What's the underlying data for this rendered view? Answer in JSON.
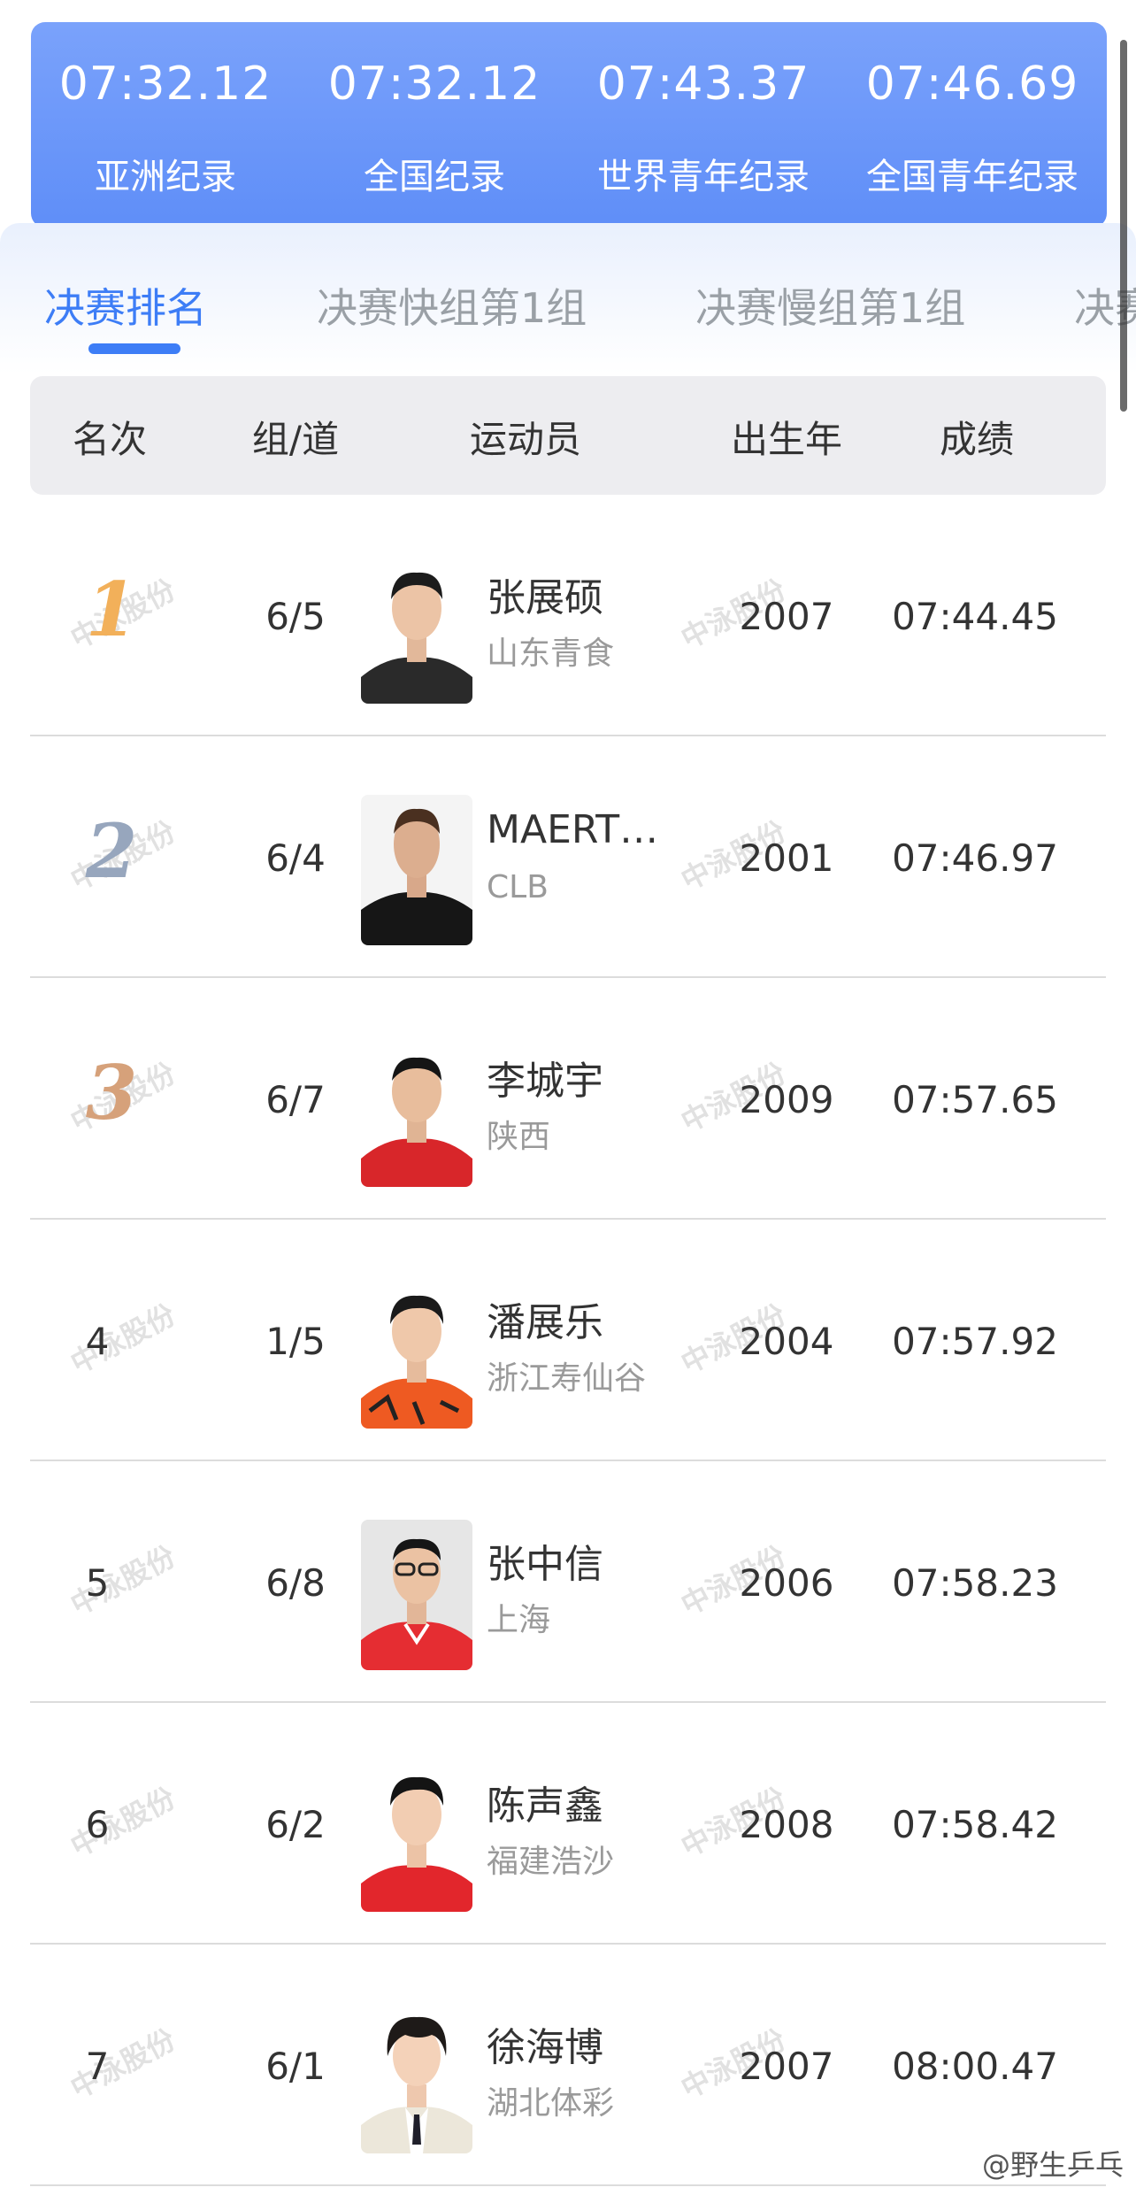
{
  "records": [
    {
      "time": "07:32.12",
      "label": "亚洲纪录"
    },
    {
      "time": "07:32.12",
      "label": "全国纪录"
    },
    {
      "time": "07:43.37",
      "label": "世界青年纪录"
    },
    {
      "time": "07:46.69",
      "label": "全国青年纪录"
    }
  ],
  "tabs": [
    "决赛排名",
    "决赛快组第1组",
    "决赛慢组第1组",
    "决赛"
  ],
  "header": {
    "rank": "名次",
    "lane": "组/道",
    "athlete": "运动员",
    "birth": "出生年",
    "score": "成绩"
  },
  "rows": [
    {
      "rank": "1",
      "lane": "6/5",
      "name": "张展硕",
      "team": "山东青食",
      "birth": "2007",
      "score": "07:44.45"
    },
    {
      "rank": "2",
      "lane": "6/4",
      "name": "MAERT…",
      "team": "CLB",
      "birth": "2001",
      "score": "07:46.97"
    },
    {
      "rank": "3",
      "lane": "6/7",
      "name": "李城宇",
      "team": "陕西",
      "birth": "2009",
      "score": "07:57.65"
    },
    {
      "rank": "4",
      "lane": "1/5",
      "name": "潘展乐",
      "team": "浙江寿仙谷",
      "birth": "2004",
      "score": "07:57.92"
    },
    {
      "rank": "5",
      "lane": "6/8",
      "name": "张中信",
      "team": "上海",
      "birth": "2006",
      "score": "07:58.23"
    },
    {
      "rank": "6",
      "lane": "6/2",
      "name": "陈声鑫",
      "team": "福建浩沙",
      "birth": "2008",
      "score": "07:58.42"
    },
    {
      "rank": "7",
      "lane": "6/1",
      "name": "徐海博",
      "team": "湖北体彩",
      "birth": "2007",
      "score": "08:00.47"
    }
  ],
  "watermark": "中泳股份",
  "credit": "@野生乒乓",
  "colors": {
    "accent": "#3d7df6",
    "banner": "#6a97f9",
    "gold": "#f2b05a",
    "silver": "#97a6bd",
    "bronze": "#d6a17a"
  }
}
